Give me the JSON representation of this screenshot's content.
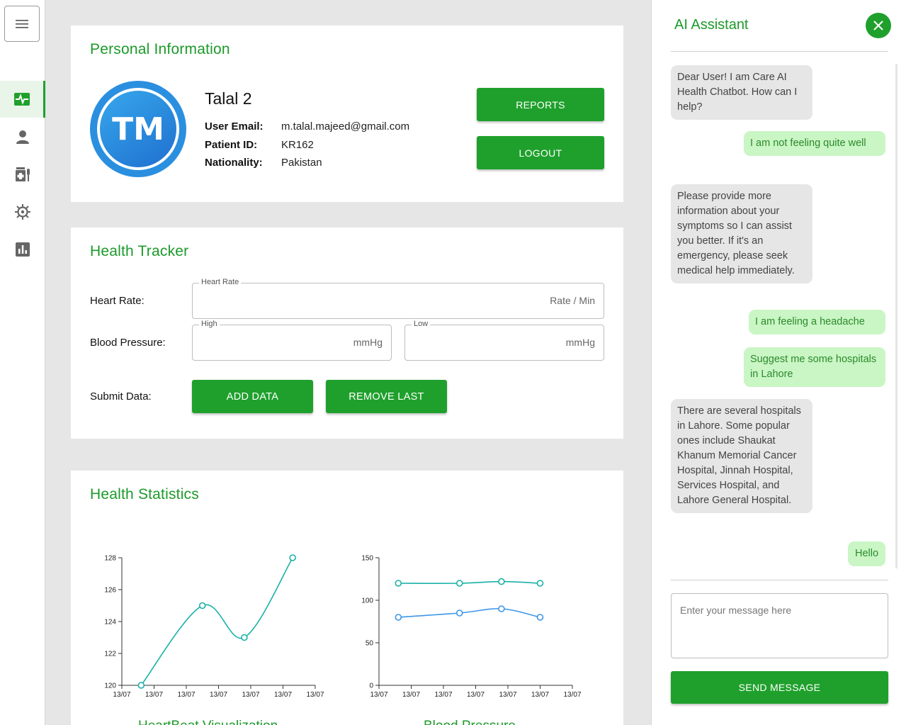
{
  "nav": {
    "items": [
      {
        "name": "health-tracker",
        "active": true
      },
      {
        "name": "profile"
      },
      {
        "name": "medicine"
      },
      {
        "name": "virus"
      },
      {
        "name": "statistics"
      }
    ]
  },
  "personal": {
    "title": "Personal Information",
    "initials": "TM",
    "name": "Talal 2",
    "email_label": "User Email:",
    "email": "m.talal.majeed@gmail.com",
    "patient_id_label": "Patient ID:",
    "patient_id": "KR162",
    "nationality_label": "Nationality:",
    "nationality": "Pakistan",
    "reports_label": "REPORTS",
    "logout_label": "LOGOUT"
  },
  "tracker": {
    "title": "Health Tracker",
    "heart_rate_label": "Heart Rate:",
    "heart_rate_legend": "Heart Rate",
    "heart_rate_unit": "Rate / Min",
    "blood_pressure_label": "Blood Pressure:",
    "high_legend": "High",
    "low_legend": "Low",
    "bp_unit": "mmHg",
    "submit_label": "Submit Data:",
    "add_label": "ADD DATA",
    "remove_label": "REMOVE LAST"
  },
  "statistics": {
    "title": "Health Statistics",
    "heart_caption": "HeartBeat Visualization",
    "bp_caption": "Blood Pressure"
  },
  "chart_data": [
    {
      "type": "line",
      "title": "HeartBeat Visualization",
      "x": [
        "13/07",
        "13/07",
        "13/07",
        "13/07"
      ],
      "x_positions": [
        0.6,
        2.5,
        3.8,
        5.3
      ],
      "xlim": [
        0,
        6
      ],
      "xticks": [
        "13/07",
        "13/07",
        "13/07",
        "13/07",
        "13/07",
        "13/07",
        "13/07"
      ],
      "series": [
        {
          "values": [
            120,
            125,
            123,
            128
          ],
          "color": "#1ab0a7"
        }
      ],
      "ylim": [
        120,
        128
      ],
      "yticks": [
        120,
        122,
        124,
        126,
        128
      ]
    },
    {
      "type": "line",
      "title": "Blood Pressure",
      "x": [
        "13/07",
        "13/07",
        "13/07",
        "13/07"
      ],
      "x_positions": [
        0.6,
        2.5,
        3.8,
        5.0
      ],
      "xlim": [
        0,
        6
      ],
      "xticks": [
        "13/07",
        "13/07",
        "13/07",
        "13/07",
        "13/07",
        "13/07",
        "13/07"
      ],
      "series": [
        {
          "values": [
            120,
            120,
            122,
            120
          ],
          "color": "#1ab0a7"
        },
        {
          "values": [
            80,
            85,
            90,
            80
          ],
          "color": "#3d96e6"
        }
      ],
      "ylim": [
        0,
        150
      ],
      "yticks": [
        0,
        50,
        100,
        150
      ]
    }
  ],
  "assistant": {
    "title": "AI Assistant",
    "messages": [
      {
        "from": "bot",
        "text": "Dear User! I am Care AI Health Chatbot. How can I help?"
      },
      {
        "from": "user",
        "text": "I am not feeling quite well"
      },
      {
        "from": "bot",
        "text": "Please provide more information about your symptoms so I can assist you better. If it's an emergency, please seek medical help immediately."
      },
      {
        "from": "user",
        "text": "I am feeling a headache"
      },
      {
        "from": "user",
        "text": "Suggest me some hospitals in Lahore"
      },
      {
        "from": "bot",
        "text": "There are several hospitals in Lahore. Some popular ones include Shaukat Khanum Memorial Cancer Hospital, Jinnah Hospital, Services Hospital, and Lahore General Hospital."
      },
      {
        "from": "user",
        "text": "Hello"
      }
    ],
    "input_placeholder": "Enter your message here",
    "send_label": "SEND MESSAGE"
  },
  "colors": {
    "accent": "#1fa02c",
    "title_green": "#1c9a2a",
    "user_bubble": "#c9f6c4",
    "bot_bubble": "#e6e6e6",
    "avatar_blue": "#2b8fe0"
  }
}
